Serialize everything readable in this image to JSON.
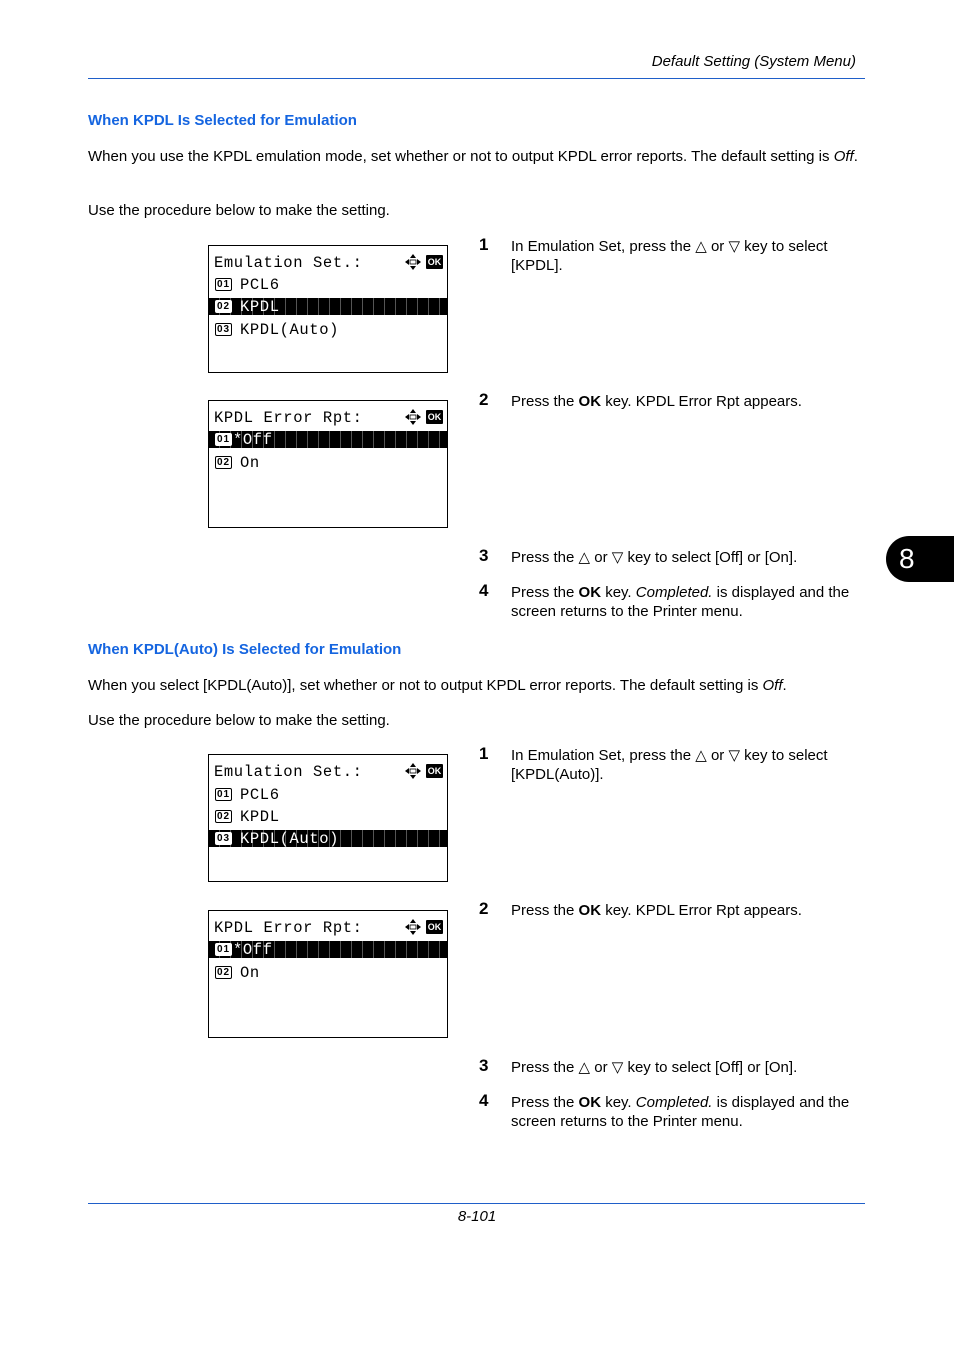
{
  "header": {
    "title": "Default Setting (System Menu)"
  },
  "chapter_tab": "8",
  "footer": {
    "page_number": "8-101"
  },
  "sections": [
    {
      "heading": "When KPDL Is Selected for Emulation",
      "intro_before_italic": "When you use the KPDL emulation mode, set whether or not to output KPDL error reports. The default setting is ",
      "intro_italic": "Off",
      "intro_after_italic": ".",
      "procedure_note": "Use the procedure below to make the setting.",
      "screens": [
        {
          "title": "Emulation Set.:",
          "icons": [
            "navigation-arrows-icon",
            "ok-key-icon"
          ],
          "rows": [
            {
              "num": "01",
              "label": "PCL6",
              "selected": false
            },
            {
              "num": "02",
              "label": "KPDL",
              "selected": true
            },
            {
              "num": "03",
              "label": "KPDL(Auto)",
              "selected": false
            }
          ]
        },
        {
          "title": "KPDL Error Rpt:",
          "icons": [
            "navigation-arrows-icon",
            "ok-key-icon"
          ],
          "rows": [
            {
              "num": "01",
              "label": "*Off",
              "selected": true
            },
            {
              "num": "02",
              "label": "On",
              "selected": false
            }
          ]
        }
      ],
      "steps": [
        {
          "num": "1",
          "text_a": "In Emulation Set, press the △ or ▽ key to select [KPDL]."
        },
        {
          "num": "2",
          "text_a": "Press the ",
          "bold": "OK",
          "text_b": " key. KPDL Error Rpt appears."
        },
        {
          "num": "3",
          "text_a": "Press the △ or ▽ key to select [Off] or [On]."
        },
        {
          "num": "4",
          "text_a": "Press the ",
          "bold": "OK",
          "text_b": " key. ",
          "italic": "Completed.",
          "text_c": " is displayed and the screen returns to the Printer menu."
        }
      ]
    },
    {
      "heading": "When KPDL(Auto) Is Selected for Emulation",
      "intro_before_italic": "When you select [KPDL(Auto)], set whether or not to output KPDL error reports. The default setting is ",
      "intro_italic": "Off",
      "intro_after_italic": ".",
      "procedure_note": "Use the procedure below to make the setting.",
      "screens": [
        {
          "title": "Emulation Set.:",
          "icons": [
            "navigation-arrows-icon",
            "ok-key-icon"
          ],
          "rows": [
            {
              "num": "01",
              "label": "PCL6",
              "selected": false
            },
            {
              "num": "02",
              "label": "KPDL",
              "selected": false
            },
            {
              "num": "03",
              "label": "KPDL(Auto)",
              "selected": true
            }
          ]
        },
        {
          "title": "KPDL Error Rpt:",
          "icons": [
            "navigation-arrows-icon",
            "ok-key-icon"
          ],
          "rows": [
            {
              "num": "01",
              "label": "*Off",
              "selected": true
            },
            {
              "num": "02",
              "label": "On",
              "selected": false
            }
          ]
        }
      ],
      "steps": [
        {
          "num": "1",
          "text_a": "In Emulation Set, press the △ or ▽ key to select [KPDL(Auto)]."
        },
        {
          "num": "2",
          "text_a": "Press the ",
          "bold": "OK",
          "text_b": " key. KPDL Error Rpt appears."
        },
        {
          "num": "3",
          "text_a": "Press the △ or ▽ key to select [Off] or [On]."
        },
        {
          "num": "4",
          "text_a": "Press the ",
          "bold": "OK",
          "text_b": " key. ",
          "italic": "Completed.",
          "text_c": " is displayed and the screen returns to the Printer menu."
        }
      ]
    }
  ],
  "colors": {
    "heading": "#1565e0",
    "rule": "#1f5fc9"
  }
}
